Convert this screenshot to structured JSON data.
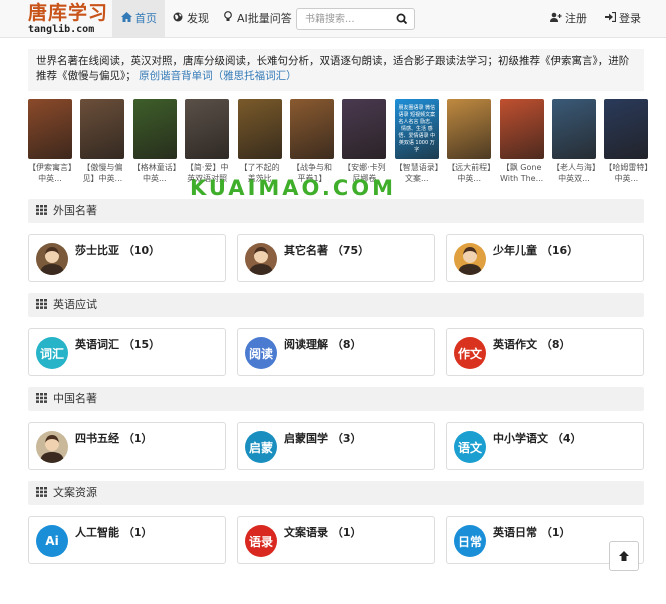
{
  "header": {
    "logo_cn": "唐库学习",
    "logo_en": "tanglib.com",
    "nav": [
      {
        "label": "首页",
        "icon": "home-icon",
        "active": true
      },
      {
        "label": "发现",
        "icon": "globe-icon",
        "active": false
      },
      {
        "label": "AI批量问答",
        "icon": "lightbulb-icon",
        "active": false
      }
    ],
    "search_placeholder": "书籍搜索...",
    "register_label": "注册",
    "login_label": "登录"
  },
  "intro": {
    "text": "世界名著在线阅读，英汉对照，唐库分级阅读，长难句分析，双语逐句朗读，适合影子跟读法学习；初级推荐《伊索寓言》，进阶推荐《傲慢与偏见》；",
    "link": "原创谐音背单词（雅思托福词汇）"
  },
  "books": [
    {
      "title": "【伊索寓言】中英...",
      "color": "#8b4a2a"
    },
    {
      "title": "【傲慢与偏见】中英...",
      "color": "#6b4f3a"
    },
    {
      "title": "【格林童话】中英...",
      "color": "#3e5f2a"
    },
    {
      "title": "【简·爱】中英双语对照",
      "color": "#5a5048"
    },
    {
      "title": "【了不起的盖茨比 Th...",
      "color": "#7a5a2a"
    },
    {
      "title": "【战争与和平卷1】中...",
      "color": "#8a5a30"
    },
    {
      "title": "【安娜·卡列尼娜卷1】...",
      "color": "#4a3a50"
    },
    {
      "title": "【智慧语录】文案...",
      "color": "#1e8fd8",
      "cover_text": "朋友圈语录 微信语录 短视频文案 名人名言 励志、情感、生活 感悟、爱情语录 中英双语 1000 万字"
    },
    {
      "title": "【远大前程】中英...",
      "color": "#c08a40"
    },
    {
      "title": "【飘 Gone With The...",
      "color": "#c05030"
    },
    {
      "title": "【老人与海】中英双...",
      "color": "#3a5a78"
    },
    {
      "title": "【哈姆雷特】中英...",
      "color": "#2a3a5a"
    }
  ],
  "watermark": "KUAIMAO.COM",
  "sections": [
    {
      "title": "外国名著",
      "items": [
        {
          "label": "莎士比亚 （10）",
          "icon": "shakespeare-portrait-icon",
          "color": "#7a5a3a"
        },
        {
          "label": "其它名著 （75）",
          "icon": "author-portrait-icon",
          "color": "#8a6040"
        },
        {
          "label": "少年儿童 （16）",
          "icon": "child-character-icon",
          "color": "#e0a040"
        }
      ]
    },
    {
      "title": "英语应试",
      "items": [
        {
          "label": "英语词汇 （15）",
          "icon_text": "词汇",
          "color": "#27b3c8"
        },
        {
          "label": "阅读理解 （8）",
          "icon_text": "阅读",
          "color": "#4a7bd0"
        },
        {
          "label": "英语作文 （8）",
          "icon_text": "作文",
          "color": "#d9321f"
        }
      ]
    },
    {
      "title": "中国名著",
      "items": [
        {
          "label": "四书五经 （1）",
          "icon": "confucius-portrait-icon",
          "color": "#c9b89a"
        },
        {
          "label": "启蒙国学 （3）",
          "icon_text": "启蒙",
          "color": "#1a8fbf"
        },
        {
          "label": "中小学语文 （4）",
          "icon_text": "语文",
          "color": "#1a9fd0"
        }
      ]
    },
    {
      "title": "文案资源",
      "items": [
        {
          "label": "人工智能 （1）",
          "icon_text": "Ai",
          "color": "#1a8fd8"
        },
        {
          "label": "文案语录 （1）",
          "icon_text": "语录",
          "color": "#d9281f"
        },
        {
          "label": "英语日常 （1）",
          "icon_text": "日常",
          "color": "#1a8fd8"
        }
      ]
    }
  ]
}
